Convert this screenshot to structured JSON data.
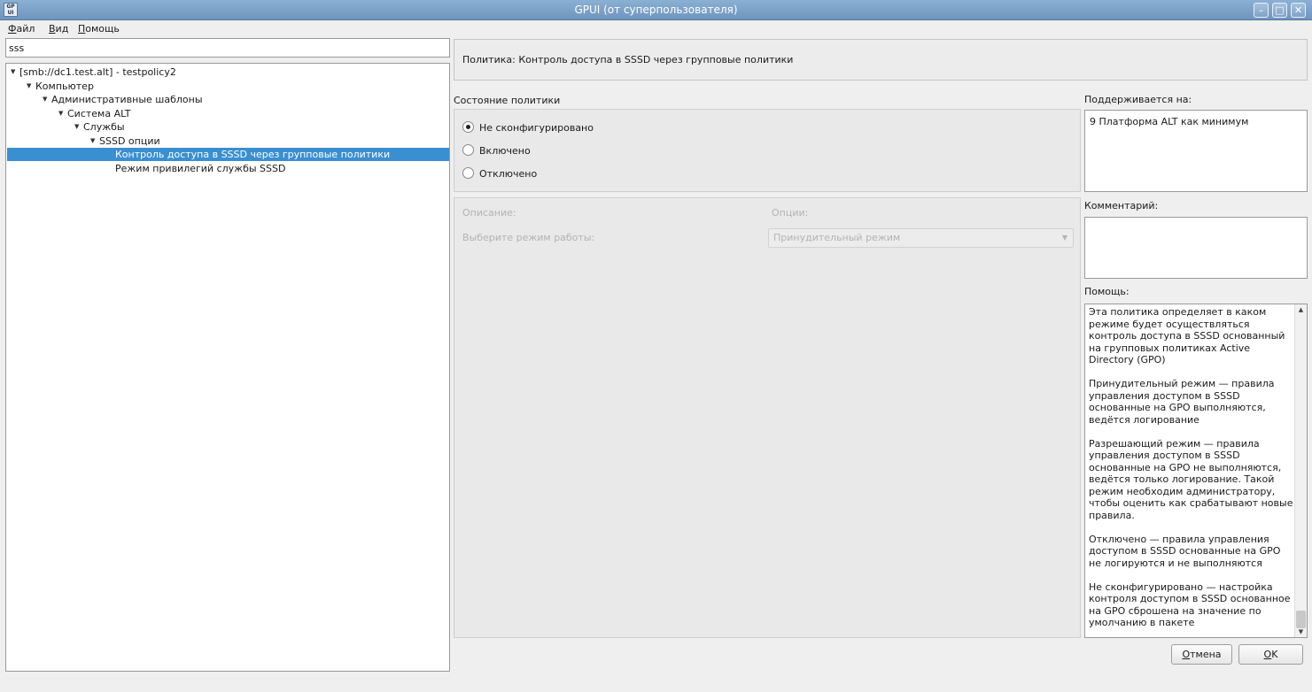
{
  "window": {
    "app_icon": "GP UI",
    "title": "GPUI (от суперпользователя)"
  },
  "menu": [
    "Файл",
    "Вид",
    "Помощь"
  ],
  "search": {
    "value": "sss"
  },
  "tree": [
    {
      "label": "[smb://dc1.test.alt] - testpolicy2",
      "level": 0,
      "expanded": true,
      "selected": false
    },
    {
      "label": "Компьютер",
      "level": 1,
      "expanded": true,
      "selected": false
    },
    {
      "label": "Административные шаблоны",
      "level": 2,
      "expanded": true,
      "selected": false
    },
    {
      "label": "Система ALT",
      "level": 3,
      "expanded": true,
      "selected": false
    },
    {
      "label": "Службы",
      "level": 4,
      "expanded": true,
      "selected": false
    },
    {
      "label": "SSSD опции",
      "level": 5,
      "expanded": true,
      "selected": false
    },
    {
      "label": "Контроль доступа в SSSD через групповые политики",
      "level": 6,
      "expanded": false,
      "selected": true
    },
    {
      "label": "Режим привилегий службы SSSD",
      "level": 6,
      "expanded": false,
      "selected": false
    }
  ],
  "policy": {
    "header": "Политика: Контроль доступа в SSSD через групповые политики"
  },
  "state": {
    "label": "Состояние политики",
    "options": [
      {
        "label": "Не сконфигурировано",
        "checked": true
      },
      {
        "label": "Включено",
        "checked": false
      },
      {
        "label": "Отключено",
        "checked": false
      }
    ]
  },
  "options_panel": {
    "description_label": "Описание:",
    "options_label": "Опции:",
    "mode_label": "Выберите режим работы:",
    "mode_value": "Принудительный режим"
  },
  "supported": {
    "label": "Поддерживается на:",
    "value": "9 Платформа ALT как минимум"
  },
  "comment": {
    "label": "Комментарий:",
    "value": ""
  },
  "help": {
    "label": "Помощь:",
    "paragraphs": [
      "Эта политика определяет в каком режиме будет осуществляться контроль доступа в SSSD основанный на групповых политиках Active Directory (GPO)",
      "Принудительный режим — правила управления доступом в SSSD основанные на GPO выполняются, ведётся логирование",
      "Разрешающий режим — правила управления доступом в SSSD основанные на GPO не выполняются, ведётся только логирование. Такой режим необходим администратору, чтобы оценить как срабатывают новые правила.",
      "Отключено — правила управления доступом в SSSD основанные на GPO не логируются и не выполняются",
      "Не сконфигурировано — настройка контроля доступом в SSSD основанное на GPO сброшена на значение по умолчанию в пакете"
    ]
  },
  "buttons": {
    "cancel": "Отмена",
    "ok": "OK"
  }
}
